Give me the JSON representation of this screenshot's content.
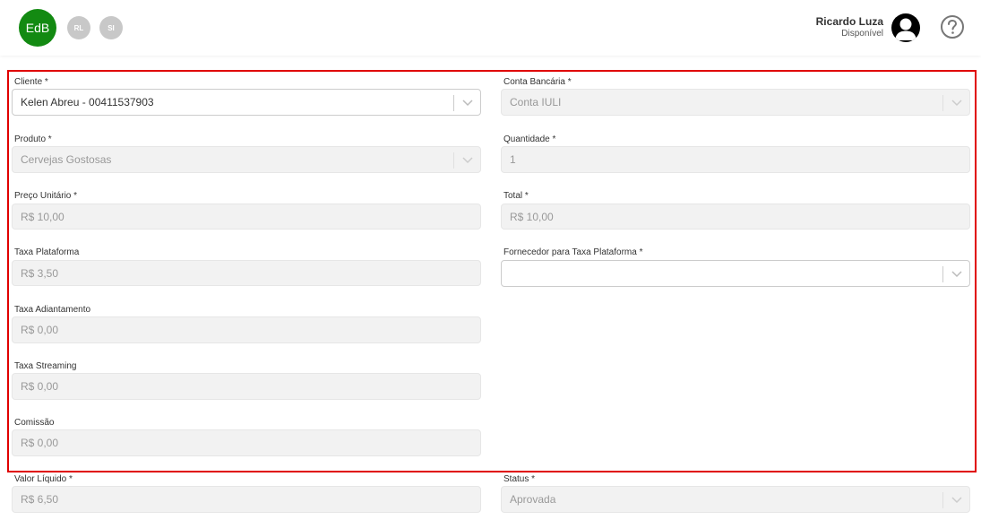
{
  "header": {
    "org_badge": "EdB",
    "badges": [
      "RL",
      "SI"
    ],
    "user_name": "Ricardo Luza",
    "user_status": "Disponível",
    "brand_color": "#138a12"
  },
  "form": {
    "cliente": {
      "label": "Cliente *",
      "value": "Kelen Abreu - 00411537903"
    },
    "conta_bancaria": {
      "label": "Conta Bancária *",
      "value": "Conta IULI"
    },
    "produto": {
      "label": "Produto *",
      "value": "Cervejas Gostosas"
    },
    "quantidade": {
      "label": "Quantidade *",
      "value": "1"
    },
    "preco_unitario": {
      "label": "Preço Unitário *",
      "value": "R$ 10,00"
    },
    "total": {
      "label": "Total *",
      "value": "R$ 10,00"
    },
    "taxa_plataforma": {
      "label": "Taxa Plataforma",
      "value": "R$ 3,50"
    },
    "fornecedor_taxa": {
      "label": "Fornecedor para Taxa Plataforma *",
      "value": ""
    },
    "taxa_adiantamento": {
      "label": "Taxa Adiantamento",
      "value": "R$ 0,00"
    },
    "taxa_streaming": {
      "label": "Taxa Streaming",
      "value": "R$ 0,00"
    },
    "comissao": {
      "label": "Comissão",
      "value": "R$ 0,00"
    },
    "valor_liquido": {
      "label": "Valor Líquido *",
      "value": "R$ 6,50"
    },
    "status": {
      "label": "Status *",
      "value": "Aprovada"
    }
  }
}
